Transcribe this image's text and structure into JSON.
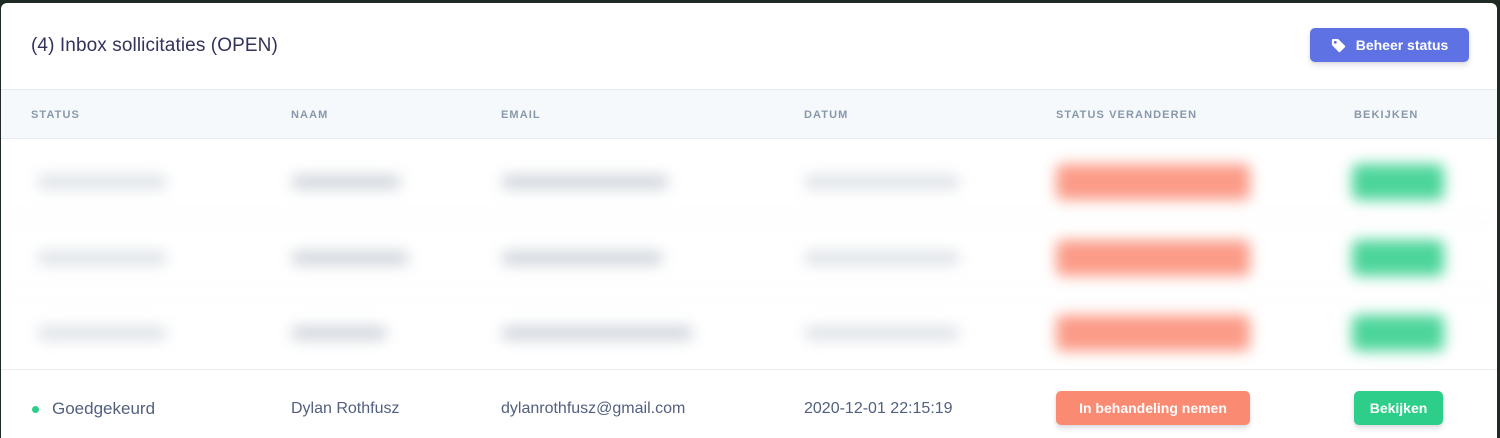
{
  "header": {
    "title": "(4) Inbox sollicitaties (OPEN)",
    "manage_button": {
      "label": "Beheer status",
      "icon": "tag-icon"
    }
  },
  "table": {
    "columns": [
      "STATUS",
      "NAAM",
      "EMAIL",
      "DATUM",
      "STATUS VERANDEREN",
      "BEKIJKEN"
    ],
    "rows": [
      {
        "status": "Goedgekeurd",
        "status_color": "#2dce89",
        "name": "Dylan Rothfusz",
        "email": "dylanrothfusz@gmail.com",
        "date": "2020-12-01 22:15:19",
        "action_label": "In behandeling nemen",
        "view_label": "Bekijken"
      }
    ]
  },
  "colors": {
    "primary": "#5e72e4",
    "warning": "#fb8a73",
    "success": "#2dce89",
    "heading": "#32325d",
    "muted": "#8898aa"
  }
}
